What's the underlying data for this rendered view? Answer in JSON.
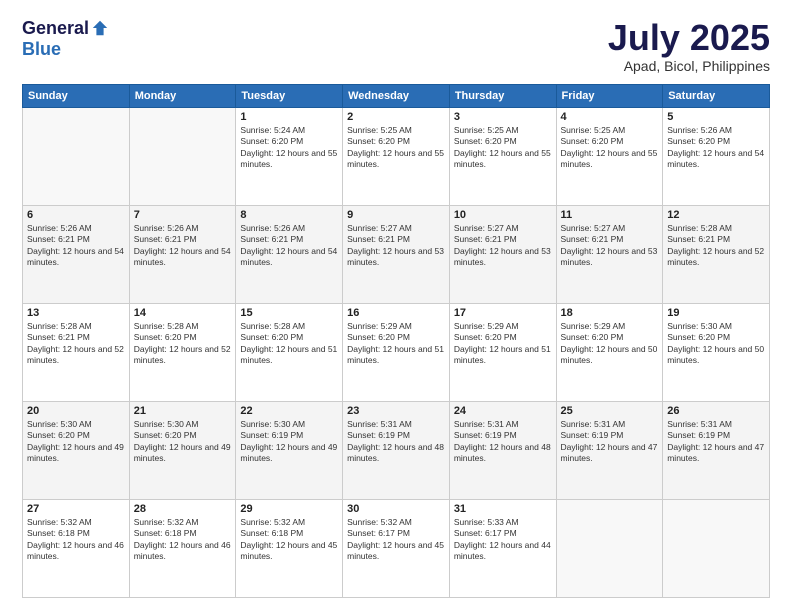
{
  "logo": {
    "general": "General",
    "blue": "Blue"
  },
  "title": "July 2025",
  "location": "Apad, Bicol, Philippines",
  "days_of_week": [
    "Sunday",
    "Monday",
    "Tuesday",
    "Wednesday",
    "Thursday",
    "Friday",
    "Saturday"
  ],
  "weeks": [
    [
      {
        "day": "",
        "info": ""
      },
      {
        "day": "",
        "info": ""
      },
      {
        "day": "1",
        "info": "Sunrise: 5:24 AM\nSunset: 6:20 PM\nDaylight: 12 hours and 55 minutes."
      },
      {
        "day": "2",
        "info": "Sunrise: 5:25 AM\nSunset: 6:20 PM\nDaylight: 12 hours and 55 minutes."
      },
      {
        "day": "3",
        "info": "Sunrise: 5:25 AM\nSunset: 6:20 PM\nDaylight: 12 hours and 55 minutes."
      },
      {
        "day": "4",
        "info": "Sunrise: 5:25 AM\nSunset: 6:20 PM\nDaylight: 12 hours and 55 minutes."
      },
      {
        "day": "5",
        "info": "Sunrise: 5:26 AM\nSunset: 6:20 PM\nDaylight: 12 hours and 54 minutes."
      }
    ],
    [
      {
        "day": "6",
        "info": "Sunrise: 5:26 AM\nSunset: 6:21 PM\nDaylight: 12 hours and 54 minutes."
      },
      {
        "day": "7",
        "info": "Sunrise: 5:26 AM\nSunset: 6:21 PM\nDaylight: 12 hours and 54 minutes."
      },
      {
        "day": "8",
        "info": "Sunrise: 5:26 AM\nSunset: 6:21 PM\nDaylight: 12 hours and 54 minutes."
      },
      {
        "day": "9",
        "info": "Sunrise: 5:27 AM\nSunset: 6:21 PM\nDaylight: 12 hours and 53 minutes."
      },
      {
        "day": "10",
        "info": "Sunrise: 5:27 AM\nSunset: 6:21 PM\nDaylight: 12 hours and 53 minutes."
      },
      {
        "day": "11",
        "info": "Sunrise: 5:27 AM\nSunset: 6:21 PM\nDaylight: 12 hours and 53 minutes."
      },
      {
        "day": "12",
        "info": "Sunrise: 5:28 AM\nSunset: 6:21 PM\nDaylight: 12 hours and 52 minutes."
      }
    ],
    [
      {
        "day": "13",
        "info": "Sunrise: 5:28 AM\nSunset: 6:21 PM\nDaylight: 12 hours and 52 minutes."
      },
      {
        "day": "14",
        "info": "Sunrise: 5:28 AM\nSunset: 6:20 PM\nDaylight: 12 hours and 52 minutes."
      },
      {
        "day": "15",
        "info": "Sunrise: 5:28 AM\nSunset: 6:20 PM\nDaylight: 12 hours and 51 minutes."
      },
      {
        "day": "16",
        "info": "Sunrise: 5:29 AM\nSunset: 6:20 PM\nDaylight: 12 hours and 51 minutes."
      },
      {
        "day": "17",
        "info": "Sunrise: 5:29 AM\nSunset: 6:20 PM\nDaylight: 12 hours and 51 minutes."
      },
      {
        "day": "18",
        "info": "Sunrise: 5:29 AM\nSunset: 6:20 PM\nDaylight: 12 hours and 50 minutes."
      },
      {
        "day": "19",
        "info": "Sunrise: 5:30 AM\nSunset: 6:20 PM\nDaylight: 12 hours and 50 minutes."
      }
    ],
    [
      {
        "day": "20",
        "info": "Sunrise: 5:30 AM\nSunset: 6:20 PM\nDaylight: 12 hours and 49 minutes."
      },
      {
        "day": "21",
        "info": "Sunrise: 5:30 AM\nSunset: 6:20 PM\nDaylight: 12 hours and 49 minutes."
      },
      {
        "day": "22",
        "info": "Sunrise: 5:30 AM\nSunset: 6:19 PM\nDaylight: 12 hours and 49 minutes."
      },
      {
        "day": "23",
        "info": "Sunrise: 5:31 AM\nSunset: 6:19 PM\nDaylight: 12 hours and 48 minutes."
      },
      {
        "day": "24",
        "info": "Sunrise: 5:31 AM\nSunset: 6:19 PM\nDaylight: 12 hours and 48 minutes."
      },
      {
        "day": "25",
        "info": "Sunrise: 5:31 AM\nSunset: 6:19 PM\nDaylight: 12 hours and 47 minutes."
      },
      {
        "day": "26",
        "info": "Sunrise: 5:31 AM\nSunset: 6:19 PM\nDaylight: 12 hours and 47 minutes."
      }
    ],
    [
      {
        "day": "27",
        "info": "Sunrise: 5:32 AM\nSunset: 6:18 PM\nDaylight: 12 hours and 46 minutes."
      },
      {
        "day": "28",
        "info": "Sunrise: 5:32 AM\nSunset: 6:18 PM\nDaylight: 12 hours and 46 minutes."
      },
      {
        "day": "29",
        "info": "Sunrise: 5:32 AM\nSunset: 6:18 PM\nDaylight: 12 hours and 45 minutes."
      },
      {
        "day": "30",
        "info": "Sunrise: 5:32 AM\nSunset: 6:17 PM\nDaylight: 12 hours and 45 minutes."
      },
      {
        "day": "31",
        "info": "Sunrise: 5:33 AM\nSunset: 6:17 PM\nDaylight: 12 hours and 44 minutes."
      },
      {
        "day": "",
        "info": ""
      },
      {
        "day": "",
        "info": ""
      }
    ]
  ]
}
